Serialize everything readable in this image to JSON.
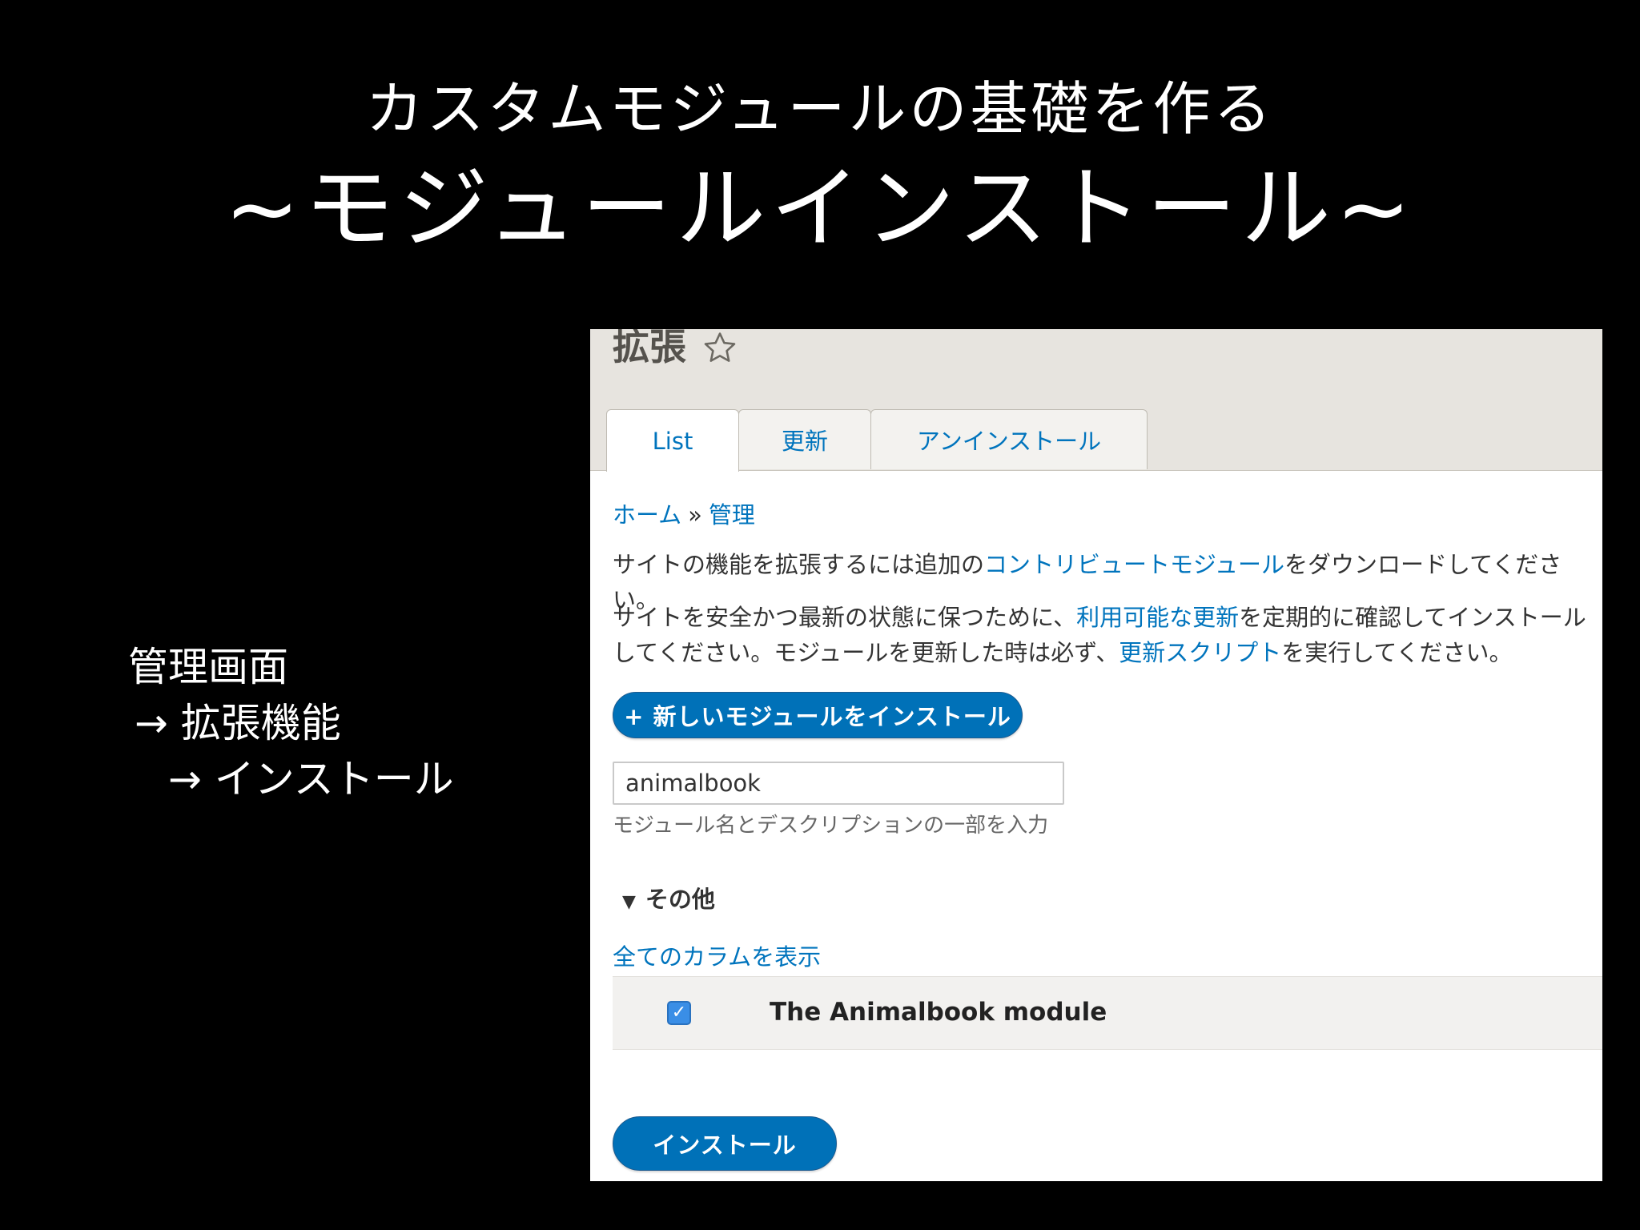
{
  "slide": {
    "title_line1": "カスタムモジュールの基礎を作る",
    "title_line2": "~モジュールインストール~",
    "side_note": [
      "管理画面",
      "→ 拡張機能",
      "→ インストール"
    ]
  },
  "screenshot": {
    "page_heading": "拡張",
    "star_icon": "star-outline-icon",
    "tabs": [
      {
        "label": "List",
        "active": true
      },
      {
        "label": "更新",
        "active": false
      },
      {
        "label": "アンインストール",
        "active": false
      }
    ],
    "breadcrumb": {
      "home": "ホーム",
      "separator": "»",
      "admin": "管理"
    },
    "paragraph1": {
      "before": "サイトの機能を拡張するには追加の",
      "link": "コントリビュートモジュール",
      "after": "をダウンロードしてください。"
    },
    "paragraph2": {
      "before": "サイトを安全かつ最新の状態に保つために、",
      "link1": "利用可能な更新",
      "middle": "を定期的に確認してインストールしてください。モジュールを更新した時は必ず、",
      "link2": "更新スクリプト",
      "after": "を実行してください。"
    },
    "new_module_button": "+ 新しいモジュールをインストール",
    "filter": {
      "value": "animalbook",
      "description": "モジュール名とデスクリプションの一部を入力"
    },
    "details": {
      "summary_icon": "triangle-down-icon",
      "summary_label": "その他"
    },
    "show_columns_link": "全てのカラムを表示",
    "module_row": {
      "checked": true,
      "check_glyph": "✓",
      "name": "The Animalbook module"
    },
    "install_button": "インストール",
    "colors": {
      "link": "#0074bd",
      "button": "#0071b8",
      "header_bg": "#e7e4df"
    }
  }
}
